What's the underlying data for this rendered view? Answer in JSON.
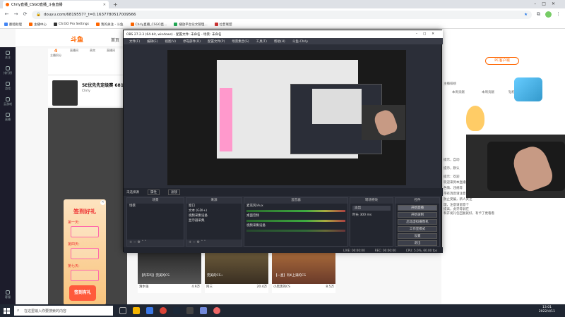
{
  "browser": {
    "tabs": [
      {
        "title": "Chrly直播_CSGO直播_斗鱼直播",
        "active": true
      }
    ],
    "url": "douyu.com/6819557?_t=0.1637780517009566",
    "bookmarks": [
      "翻墙助理",
      "主播中心",
      "CS:GO Pro Settings",
      "我的关注 - 斗鱼",
      "Chrly直播_CSGO直...",
      "播放平台论文管理...",
      "拉普联盟"
    ]
  },
  "douyu": {
    "logo": "斗鱼",
    "home": "首页",
    "left_nav": [
      "关注",
      "排行榜",
      "游戏",
      "云游戏",
      "直播",
      "客服"
    ],
    "stats": [
      {
        "label": "主播积分",
        "value": "4"
      },
      {
        "label": "直播间",
        "value": ""
      },
      {
        "label": "贵宾",
        "value": ""
      },
      {
        "label": "直播间",
        "value": ""
      }
    ],
    "room_title": "5E优先先定级赛 6819",
    "anchor_name": "Chrly",
    "checkin": {
      "title": "签到好礼",
      "days": [
        "第一天:",
        "第四天:",
        "第七天:"
      ],
      "button": "签到有礼"
    },
    "right": {
      "pc_client": "PC客户端",
      "tabs": [
        "主播排榜",
        "本周贡献",
        "本周贡献",
        "贵族",
        "钻粉"
      ],
      "chat": [
        "提示，自动",
        "提示，默认",
        "提示：欢迎",
        "欢迎来到本直播间，斗鱼禁止",
        "色情、违规等",
        "带有消息请注意",
        "防止受骗，新人关注",
        "理，注意请留意个",
        "提高，虎牙等弱在",
        "和开发礼包回复就好，有卡了更看看"
      ]
    },
    "cards": [
      {
        "title": "【有车吗】完美的CS",
        "user": "清水张",
        "hot": "4.9万"
      },
      {
        "title": "完美的CS~",
        "user": "阿三",
        "hot": "20.4万"
      },
      {
        "title": "【一直】有K上满的CS",
        "user": "小黑黑的CS",
        "hot": "8.5万"
      }
    ]
  },
  "obs": {
    "title": "OBS 27.2.3 (64-bit, windows) - 配置文件: 未命名 - 场景: 未命名",
    "menu": [
      "文件(F)",
      "编辑(E)",
      "视图(V)",
      "停靠部件(D)",
      "配置文件(P)",
      "场景集合(S)",
      "工具(T)",
      "帮助(H)",
      "斗鱼-Chrly"
    ],
    "scene_bar": [
      "未选择源",
      "属性",
      "滤镜"
    ],
    "docks": {
      "scenes": {
        "header": "场景",
        "items": [
          "场景"
        ]
      },
      "sources": {
        "header": "来源",
        "items": [
          "窗口",
          "文本 (GDI+)",
          "视频采集设备",
          "显示器采集"
        ]
      },
      "mixer": {
        "header": "混音器",
        "items": [
          "麦克风/Aux",
          "桌面音频",
          "视频采集设备"
        ]
      },
      "transitions": {
        "header": "转场特效",
        "fade": "淡出",
        "duration_label": "时长",
        "duration": "300 ms"
      },
      "controls": {
        "header": "控件",
        "items": [
          "开始直播",
          "开始录制",
          "启动虚拟摄像机",
          "工作室模式",
          "设置",
          "退出"
        ]
      }
    },
    "status": [
      "LIVE: 00:00:00",
      "REC: 00:00:00",
      "CPU: 5.0%, 60.00 fps"
    ]
  },
  "taskbar": {
    "search_placeholder": "在这里输入你要搜索的内容",
    "time": "13:01",
    "date": "2022/4/11"
  },
  "colors": {
    "accent": "#ff6600",
    "obs_bg": "#2b2e38",
    "selection": "#3f4f7a",
    "taskbar": "#1f2632"
  }
}
